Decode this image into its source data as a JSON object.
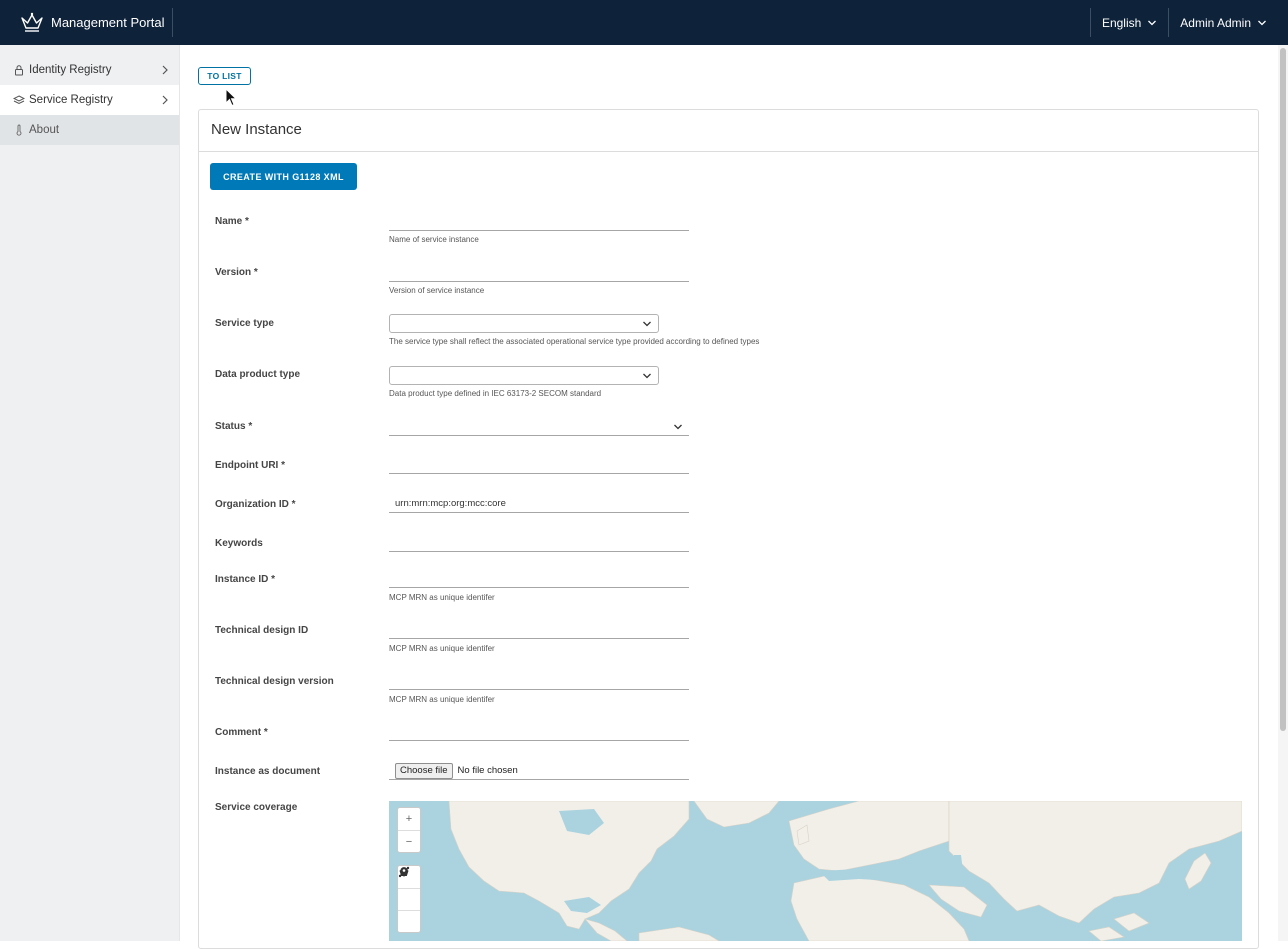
{
  "header": {
    "app_title": "Management Portal",
    "language": "English",
    "user": "Admin Admin"
  },
  "sidebar": {
    "items": [
      {
        "label": "Identity Registry",
        "icon": "lock-icon"
      },
      {
        "label": "Service Registry",
        "icon": "layers-icon"
      },
      {
        "label": "About",
        "icon": "thermometer-icon"
      }
    ]
  },
  "toolbar": {
    "to_list_label": "TO LIST"
  },
  "form": {
    "title": "New Instance",
    "create_xml_label": "CREATE WITH G1128 XML",
    "fields": {
      "name": {
        "label": "Name *",
        "value": "",
        "help": "Name of service instance"
      },
      "version": {
        "label": "Version *",
        "value": "",
        "help": "Version of service instance"
      },
      "service_type": {
        "label": "Service type",
        "value": "",
        "help": "The service type shall reflect the associated operational service type provided according to defined types"
      },
      "data_product_type": {
        "label": "Data product type",
        "value": "",
        "help": "Data product type defined in IEC 63173-2 SECOM standard"
      },
      "status": {
        "label": "Status *",
        "value": ""
      },
      "endpoint_uri": {
        "label": "Endpoint URI *",
        "value": ""
      },
      "organization_id": {
        "label": "Organization ID *",
        "value": "urn:mrn:mcp:org:mcc:core"
      },
      "keywords": {
        "label": "Keywords",
        "value": ""
      },
      "instance_id": {
        "label": "Instance ID *",
        "value": "",
        "help": "MCP MRN as unique identifer"
      },
      "technical_design_id": {
        "label": "Technical design ID",
        "value": "",
        "help": "MCP MRN as unique identifer"
      },
      "technical_design_version": {
        "label": "Technical design version",
        "value": "",
        "help": "MCP MRN as unique identifer"
      },
      "comment": {
        "label": "Comment *",
        "value": ""
      },
      "instance_document": {
        "label": "Instance as document",
        "button": "Choose file",
        "status": "No file chosen"
      },
      "service_coverage": {
        "label": "Service coverage"
      }
    }
  },
  "map": {
    "zoom_in": "+",
    "zoom_out": "−",
    "tools": [
      "draw-line-icon",
      "draw-polygon-icon",
      "draw-marker-icon"
    ],
    "colors": {
      "water": "#aad3df",
      "land": "#f2efe9"
    }
  }
}
